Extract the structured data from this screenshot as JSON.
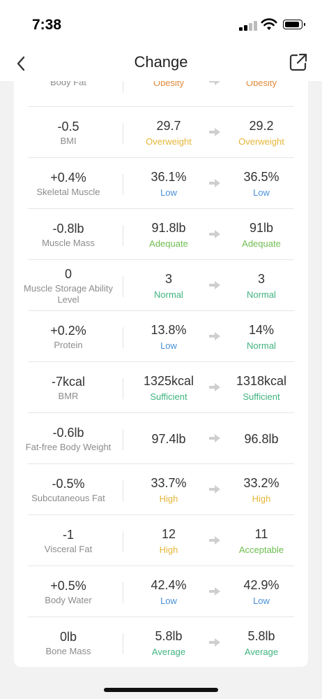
{
  "status_bar": {
    "time": "7:38"
  },
  "nav": {
    "title": "Change"
  },
  "colors": {
    "orange": "#e08a3c",
    "yellow": "#e5b638",
    "blue": "#4a90d6",
    "green": "#6ebd50",
    "teal": "#3fb37f"
  },
  "rows": [
    {
      "delta": "",
      "metric": "Body Fat",
      "before": "",
      "before_level": "Obesity",
      "before_color": "#e08a3c",
      "after": "",
      "after_level": "Obesity",
      "after_color": "#e08a3c"
    },
    {
      "delta": "-0.5",
      "metric": "BMI",
      "before": "29.7",
      "before_level": "Overweight",
      "before_color": "#e5b638",
      "after": "29.2",
      "after_level": "Overweight",
      "after_color": "#e5b638"
    },
    {
      "delta": "+0.4%",
      "metric": "Skeletal Muscle",
      "before": "36.1%",
      "before_level": "Low",
      "before_color": "#4a90d6",
      "after": "36.5%",
      "after_level": "Low",
      "after_color": "#4a90d6"
    },
    {
      "delta": "-0.8lb",
      "metric": "Muscle Mass",
      "before": "91.8lb",
      "before_level": "Adequate",
      "before_color": "#6ebd50",
      "after": "91lb",
      "after_level": "Adequate",
      "after_color": "#6ebd50"
    },
    {
      "delta": "0",
      "metric": "Muscle Storage Ability Level",
      "before": "3",
      "before_level": "Normal",
      "before_color": "#3fb37f",
      "after": "3",
      "after_level": "Normal",
      "after_color": "#3fb37f"
    },
    {
      "delta": "+0.2%",
      "metric": "Protein",
      "before": "13.8%",
      "before_level": "Low",
      "before_color": "#4a90d6",
      "after": "14%",
      "after_level": "Normal",
      "after_color": "#3fb37f"
    },
    {
      "delta": "-7kcal",
      "metric": "BMR",
      "before": "1325kcal",
      "before_level": "Sufficient",
      "before_color": "#3fb37f",
      "after": "1318kcal",
      "after_level": "Sufficient",
      "after_color": "#3fb37f"
    },
    {
      "delta": "-0.6lb",
      "metric": "Fat-free Body Weight",
      "before": "97.4lb",
      "before_level": "",
      "before_color": "#333333",
      "after": "96.8lb",
      "after_level": "",
      "after_color": "#333333"
    },
    {
      "delta": "-0.5%",
      "metric": "Subcutaneous Fat",
      "before": "33.7%",
      "before_level": "High",
      "before_color": "#e5b638",
      "after": "33.2%",
      "after_level": "High",
      "after_color": "#e5b638"
    },
    {
      "delta": "-1",
      "metric": "Visceral Fat",
      "before": "12",
      "before_level": "High",
      "before_color": "#e5b638",
      "after": "11",
      "after_level": "Acceptable",
      "after_color": "#6ebd50"
    },
    {
      "delta": "+0.5%",
      "metric": "Body Water",
      "before": "42.4%",
      "before_level": "Low",
      "before_color": "#4a90d6",
      "after": "42.9%",
      "after_level": "Low",
      "after_color": "#4a90d6"
    },
    {
      "delta": "0lb",
      "metric": "Bone Mass",
      "before": "5.8lb",
      "before_level": "Average",
      "before_color": "#3fb37f",
      "after": "5.8lb",
      "after_level": "Average",
      "after_color": "#3fb37f"
    }
  ]
}
